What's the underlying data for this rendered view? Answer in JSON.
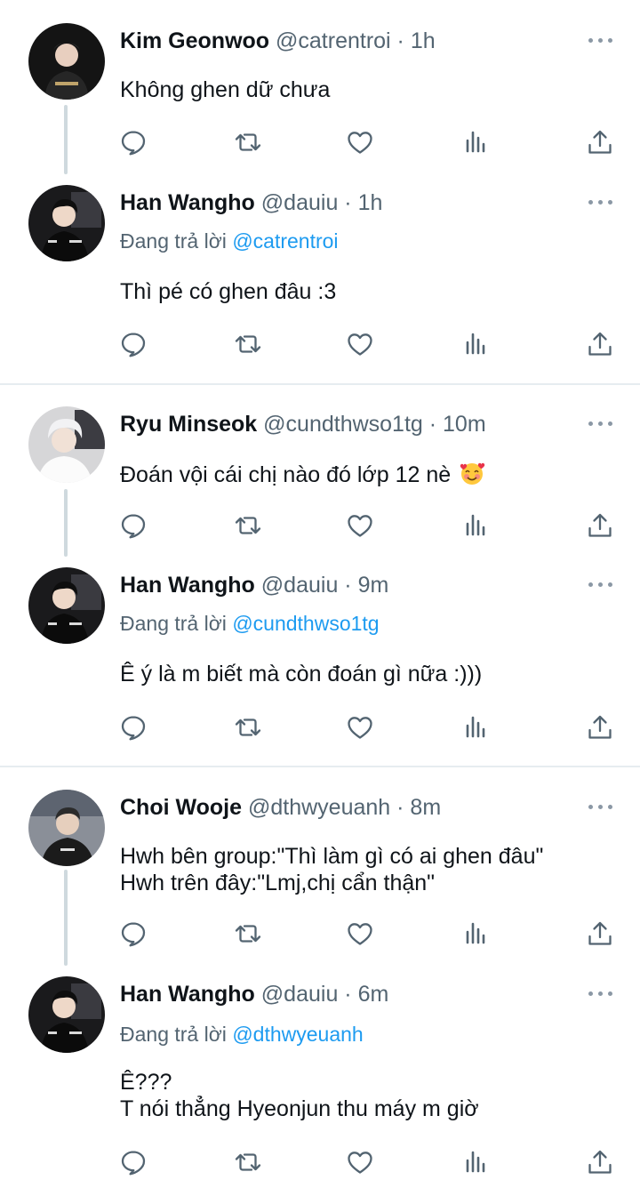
{
  "groups": [
    {
      "original": {
        "name": "Kim Geonwoo",
        "handle": "@catrentroi",
        "time": "1h",
        "text": "Không ghen dữ chưa"
      },
      "reply": {
        "name": "Han Wangho",
        "handle": "@dauiu",
        "time": "1h",
        "replying_label": "Đang trả lời",
        "replying_to": "@catrentroi",
        "text": "Thì pé có ghen đâu :3"
      }
    },
    {
      "original": {
        "name": "Ryu Minseok",
        "handle": "@cundthwso1tg",
        "time": "10m",
        "text": "Đoán vội cái chị nào đó lớp 12 nè",
        "emoji": "smiling-face-with-hearts"
      },
      "reply": {
        "name": "Han Wangho",
        "handle": "@dauiu",
        "time": "9m",
        "replying_label": "Đang trả lời",
        "replying_to": "@cundthwso1tg",
        "text": "Ê ý là m biết mà còn đoán gì nữa :)))"
      }
    },
    {
      "original": {
        "name": "Choi Wooje",
        "handle": "@dthwyeuanh",
        "time": "8m",
        "text": "Hwh bên group:\"Thì làm gì có ai ghen đâu\"\nHwh trên đây:\"Lmj,chị cẩn thận\""
      },
      "reply": {
        "name": "Han Wangho",
        "handle": "@dauiu",
        "time": "6m",
        "replying_label": "Đang trả lời",
        "replying_to": "@dthwyeuanh",
        "text": "Ê???\nT nói thẳng Hyeonjun thu máy m giờ"
      }
    }
  ],
  "separator": " · ",
  "icons": [
    "reply-icon",
    "retweet-icon",
    "like-icon",
    "views-icon",
    "share-icon",
    "more-icon"
  ],
  "colors": {
    "text": "#0f1419",
    "secondary": "#536471",
    "mention": "#1d9bf0",
    "icon": "#536471",
    "thread_line": "#cfd9de",
    "divider": "#e6ecf0"
  }
}
